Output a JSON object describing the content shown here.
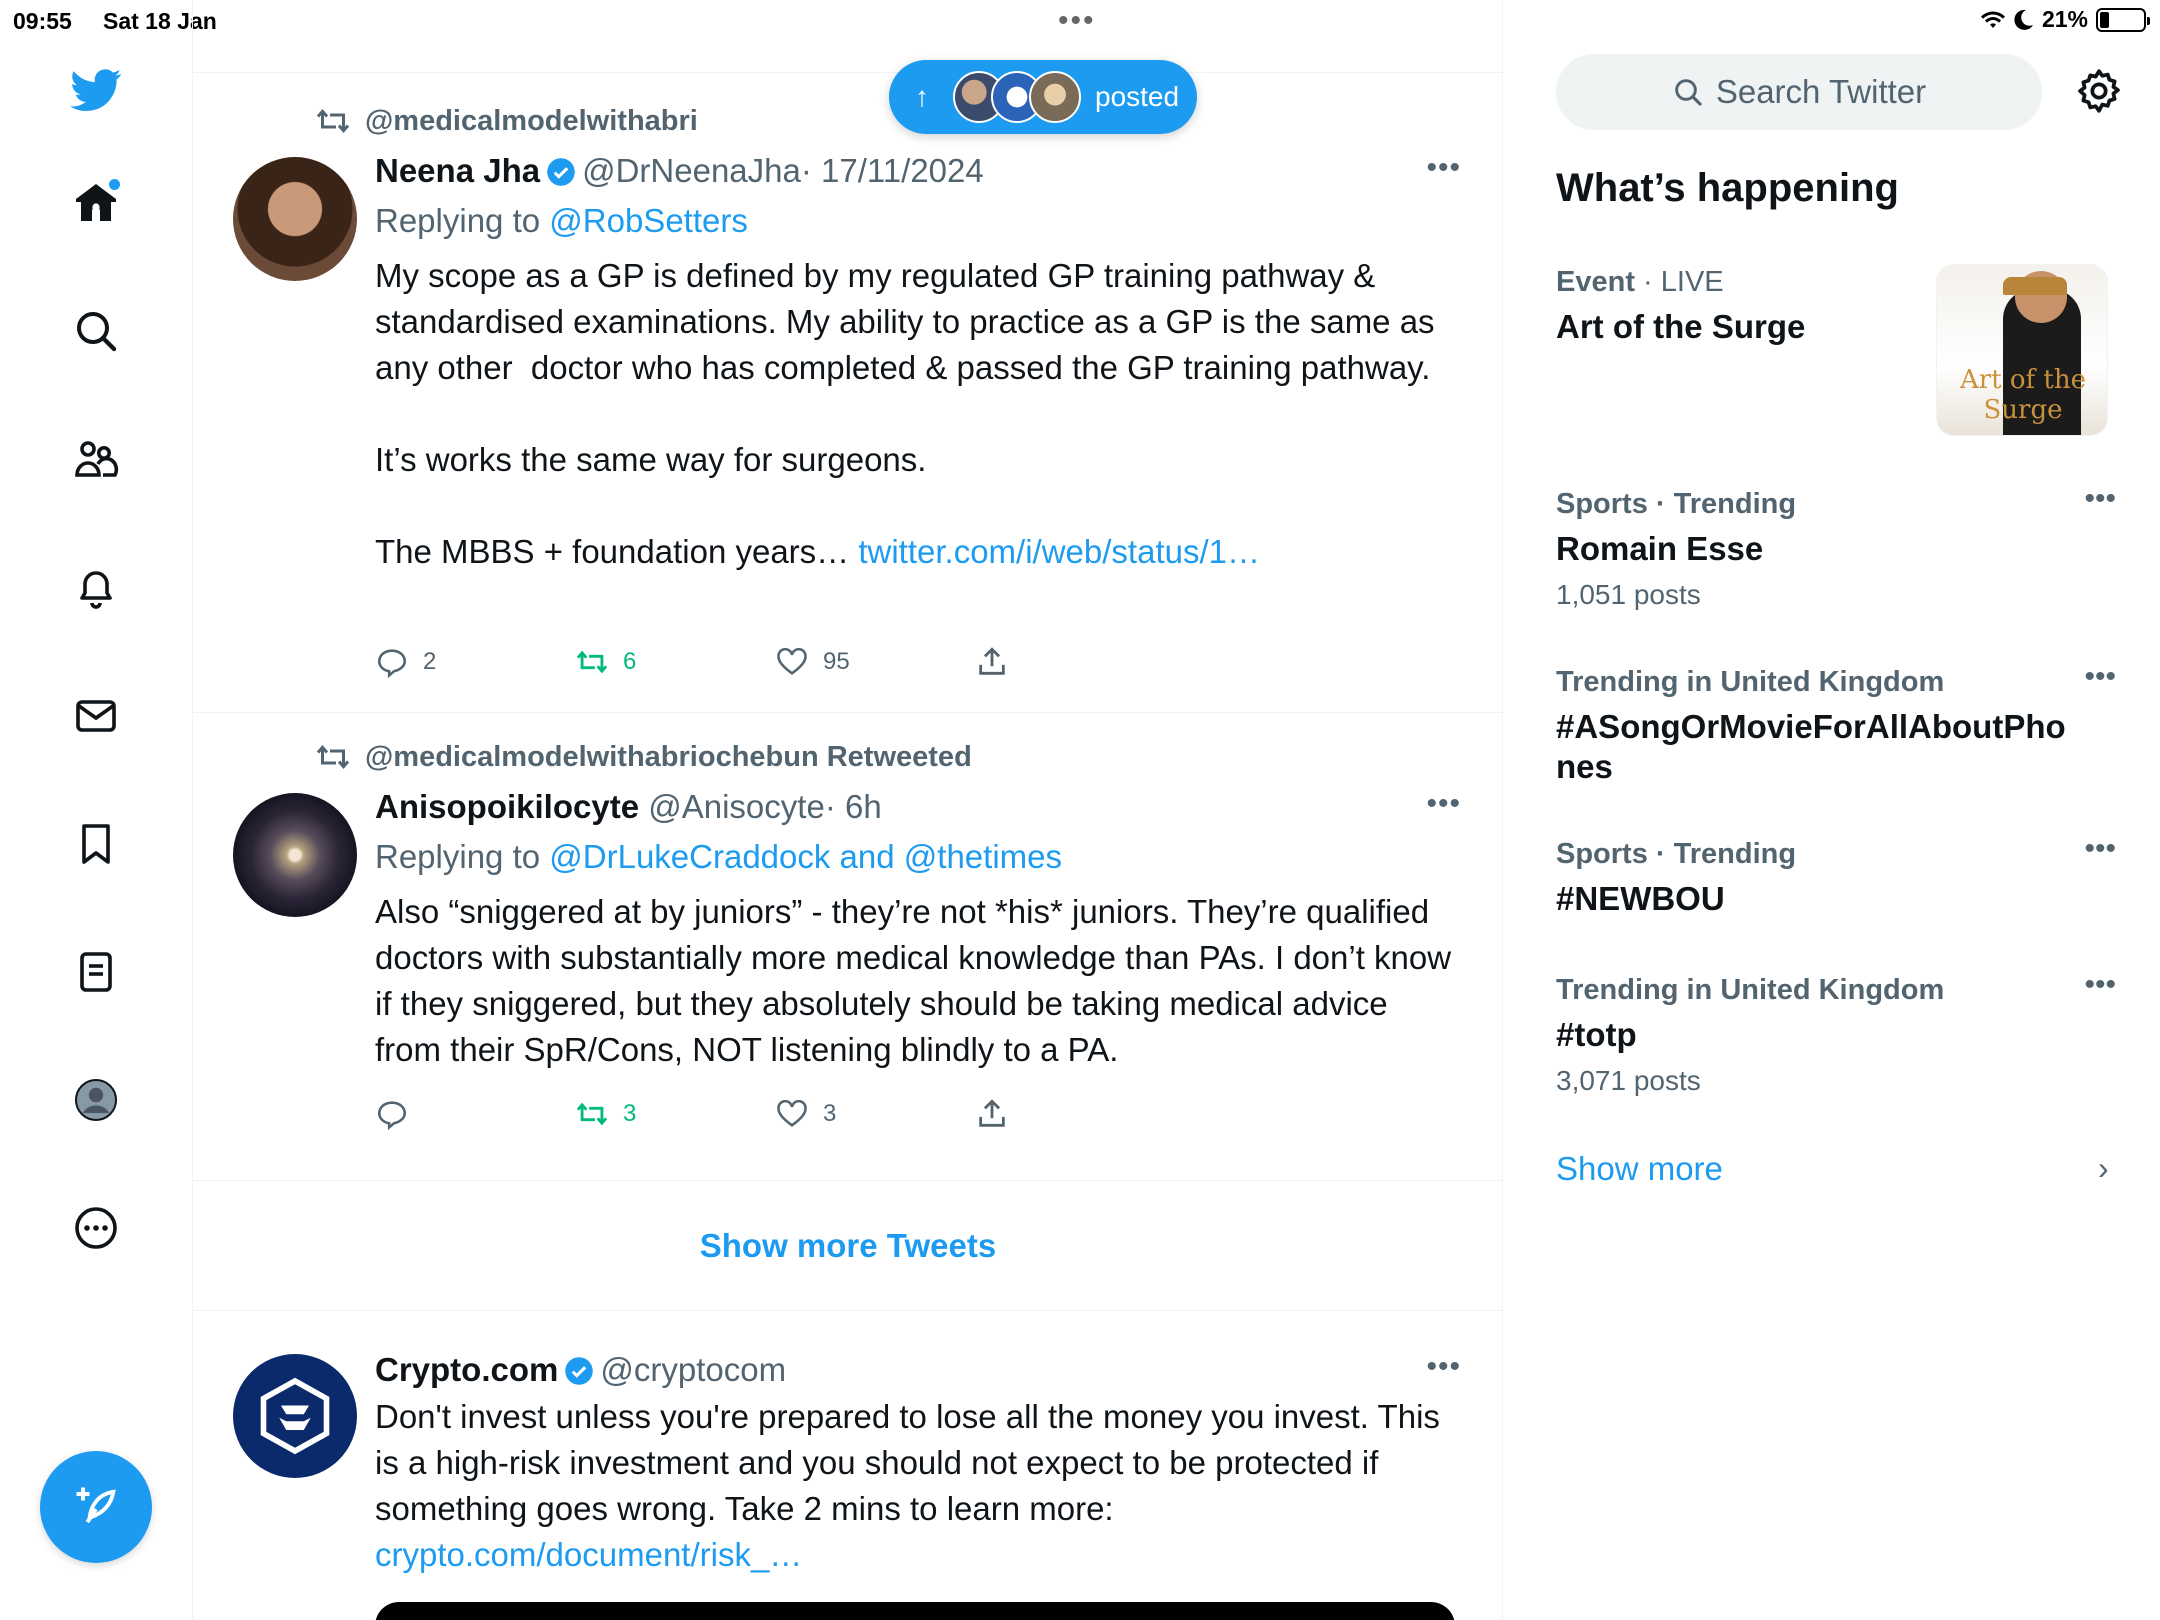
{
  "status_bar": {
    "time": "09:55",
    "date": "Sat 18 Jan",
    "center_dots": "•••",
    "battery": "21%",
    "battery_level": 0.21
  },
  "nav": {
    "items": [
      "home-icon",
      "search-icon",
      "communities-icon",
      "notifications-icon",
      "messages-icon",
      "bookmarks-icon",
      "lists-icon",
      "profile-icon",
      "more-icon"
    ],
    "compose_icon": "compose-icon"
  },
  "pill": {
    "arrow": "↑",
    "label": "posted"
  },
  "tweets": [
    {
      "retweeted_by": "@medicalmodelwithabri",
      "name": "Neena Jha",
      "handle": "@DrNeenaJha",
      "time": "· 17/11/2024",
      "reply_prefix": "Replying to ",
      "reply_to": "@RobSetters",
      "text": "My scope as a GP is defined by my regulated GP training pathway & standardised examinations. My ability to practice as a GP is the same as any other  doctor who has completed & passed the GP training pathway.\n\nIt’s works the same way for surgeons.\n\nThe MBBS + foundation years… ",
      "link": "twitter.com/i/web/status/1…",
      "replies": "2",
      "retweets": "6",
      "likes": "95",
      "more": "•••"
    },
    {
      "retweeted_by": "@medicalmodelwithabriochebun Retweeted",
      "name": "Anisopoikilocyte",
      "handle": "@Anisocyte",
      "time": "· 6h",
      "reply_prefix": "Replying to ",
      "reply_to": "@DrLukeCraddock and @thetimes",
      "text": "Also “sniggered at by juniors” - they’re not *his* juniors. They’re qualified doctors with substantially more medical knowledge than PAs. I don’t know if they sniggered, but they absolutely should be taking medical advice from their SpR/Cons, NOT listening blindly to a PA.",
      "replies": "",
      "retweets": "3",
      "likes": "3",
      "more": "•••"
    }
  ],
  "show_more_tweets": "Show more Tweets",
  "ad": {
    "name": "Crypto.com",
    "handle": "@cryptocom",
    "text": "Don't invest unless you're prepared to lose all the money you invest. This is a high-risk investment and you should not expect to be protected if something goes wrong. Take 2 mins to learn more: ",
    "link": "crypto.com/document/risk_…",
    "more": "•••"
  },
  "right": {
    "search_placeholder": "Search Twitter",
    "whats_happening": "What’s happening",
    "event": {
      "category": "Event",
      "sep": " · ",
      "status": "LIVE",
      "title": "Art of the Surge",
      "image_text": "Art of the Surge"
    },
    "trends": [
      {
        "meta": "Sports · Trending",
        "title": "Romain Esse",
        "count": "1,051 posts"
      },
      {
        "meta": "Trending in United Kingdom",
        "title": "#ASongOrMovieForAllAboutPho nes",
        "count": ""
      },
      {
        "meta": "Sports · Trending",
        "title": "#NEWBOU",
        "count": ""
      },
      {
        "meta": "Trending in United Kingdom",
        "title": "#totp",
        "count": "3,071 posts"
      }
    ],
    "trend_more": "•••",
    "show_more": "Show more",
    "chevron": "›"
  },
  "colors": {
    "accent": "#1d9bf0",
    "retweet_green": "#00ba7c",
    "secondary_text": "#536471"
  }
}
